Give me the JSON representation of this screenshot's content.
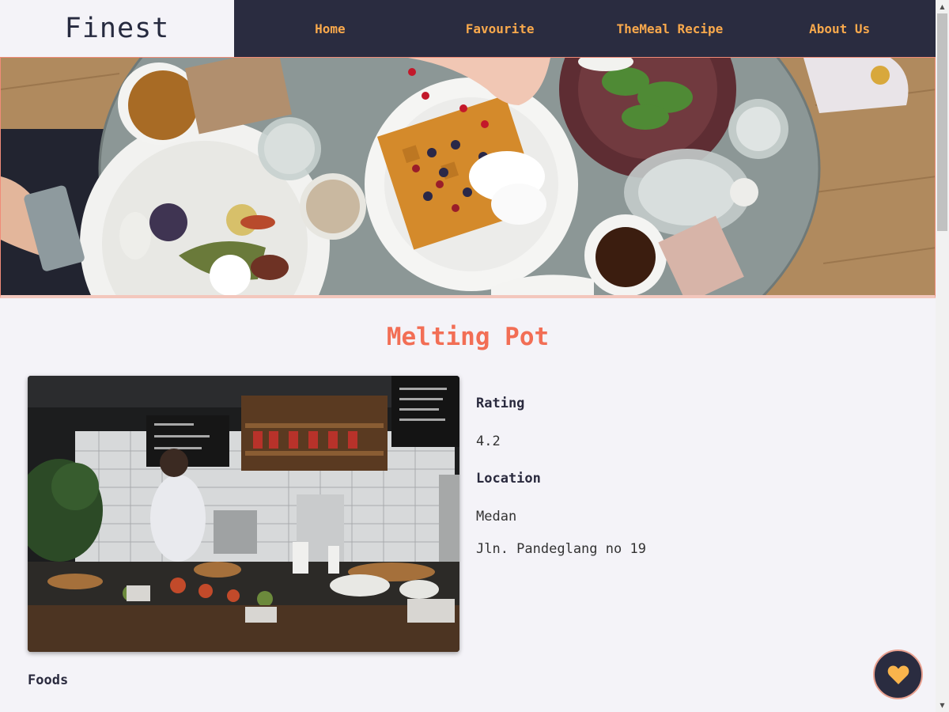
{
  "brand": {
    "name": "Finest"
  },
  "nav": {
    "items": [
      {
        "label": "Home"
      },
      {
        "label": "Favourite"
      },
      {
        "label": "TheMeal Recipe"
      },
      {
        "label": "About Us"
      }
    ]
  },
  "restaurant": {
    "name": "Melting Pot",
    "rating_label": "Rating",
    "rating": "4.2",
    "location_label": "Location",
    "city": "Medan",
    "address": "Jln. Pandeglang no 19"
  },
  "foods": {
    "heading": "Foods"
  },
  "favorite_button": {
    "icon": "heart-icon"
  },
  "colors": {
    "nav_bg": "#2a2c40",
    "nav_text": "#f9a94c",
    "title": "#f26e55",
    "page_bg": "#f4f3f8",
    "heart": "#f9b44c"
  }
}
